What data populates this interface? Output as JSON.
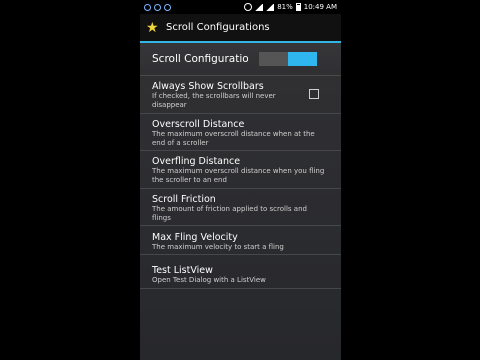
{
  "status_bar": {
    "battery": "81%",
    "time": "10:49 AM"
  },
  "action_bar": {
    "title": "Scroll Configurations"
  },
  "header": {
    "label": "Scroll Configuration",
    "toggle_state": "on"
  },
  "items": [
    {
      "title": "Always Show Scrollbars",
      "summary": "If checked, the scrollbars will never disappear",
      "checked": false
    },
    {
      "title": "Overscroll Distance",
      "summary": "The maximum overscroll distance when at the end of a scroller"
    },
    {
      "title": "Overfling Distance",
      "summary": "The maximum overscroll distance when you fling the scroller to an end"
    },
    {
      "title": "Scroll Friction",
      "summary": "The amount of friction applied to scrolls and flings"
    },
    {
      "title": "Max Fling Velocity",
      "summary": "The maximum velocity to start a fling"
    },
    {
      "title": "Test ListView",
      "summary": "Open Test Dialog with a ListView"
    }
  ],
  "colors": {
    "accent": "#33b5e5",
    "toggle_on": "#2fb6ef",
    "background": "#303033"
  }
}
